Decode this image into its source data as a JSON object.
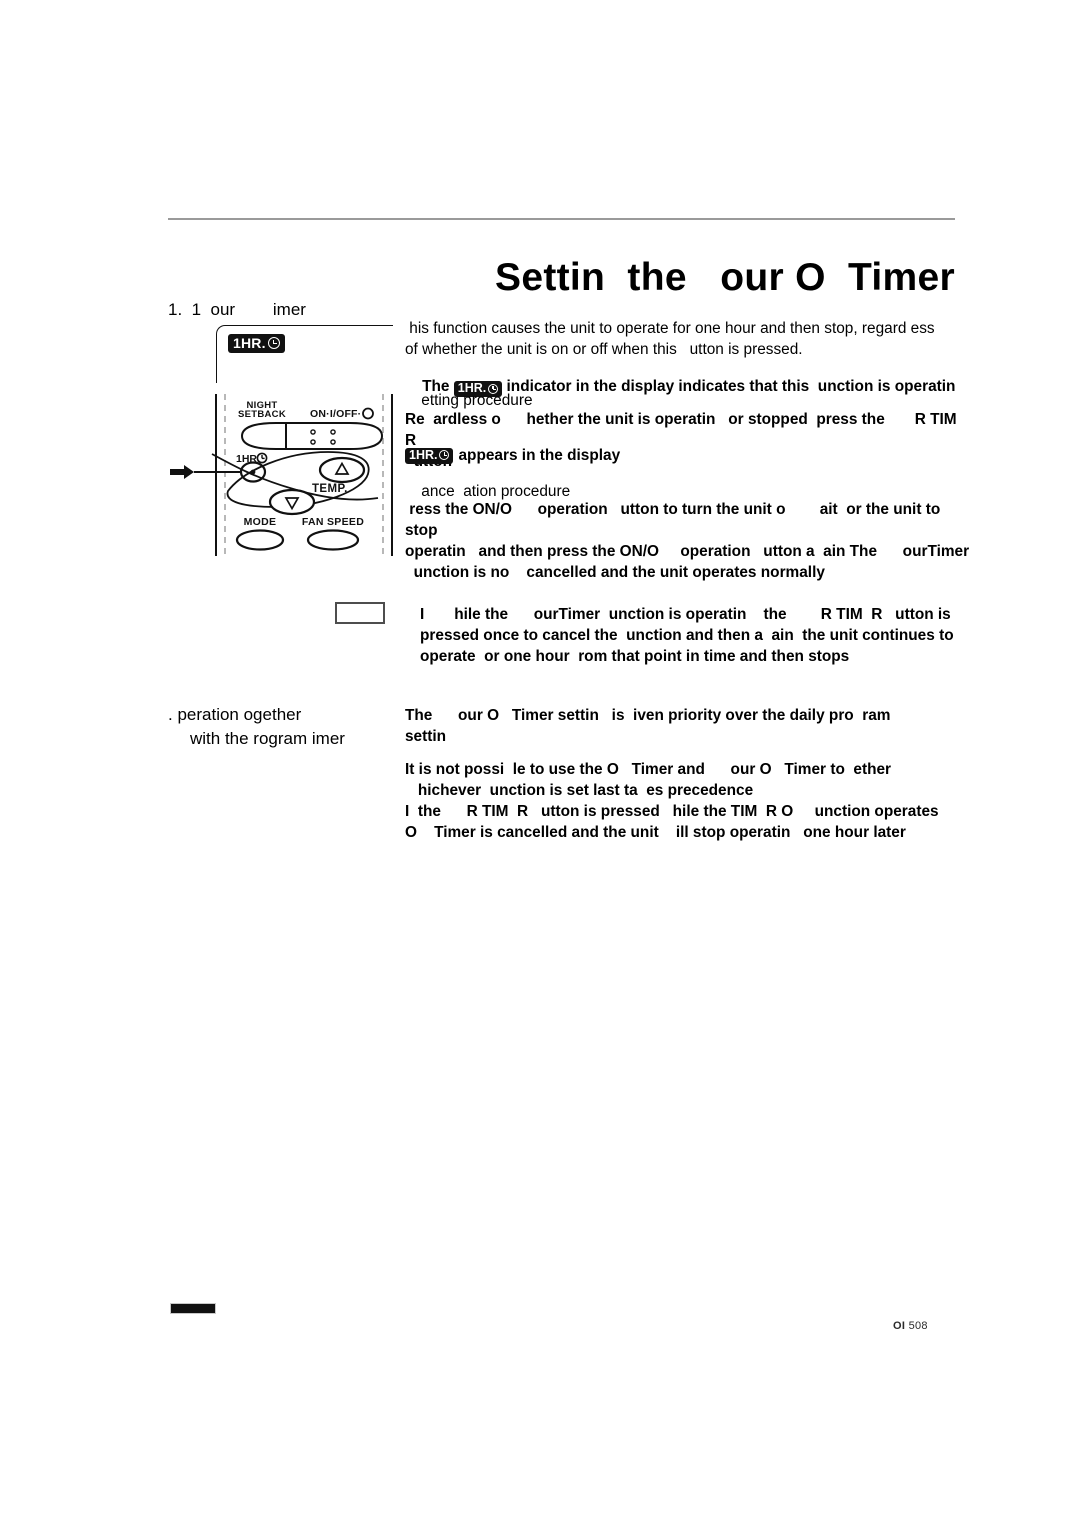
{
  "document": {
    "title": "Settin  the   our O  Timer",
    "footer_code_prefix": "OI",
    "footer_code_number": "508"
  },
  "section1": {
    "heading": "1.  1  our        imer",
    "display_badge": {
      "text": "1HR.",
      "icon": "clock-icon"
    },
    "intro_paragraph": " his function causes the unit to operate for one hour and then stop, regard ess\nof whether the unit is on or off when this   utton is pressed.",
    "intro_bold_before": "The ",
    "intro_bold_after": " indicator in the display indicates that this  unction is operatin",
    "setting_label": " etting procedure",
    "setting_body": "Re  ardless o      hether the unit is operatin   or stopped  press the       R TIM  R\n  utton",
    "setting_display_text": "appears in the display",
    "cancel_label": " ance  ation procedure",
    "cancel_body": " ress the ON/O      operation   utton to turn the unit o        ait  or the unit to stop\noperatin   and then press the ON/O     operation   utton a  ain The      ourTimer\n  unction is no    cancelled and the unit operates normally",
    "note_text": "I       hile the      ourTimer  unction is operatin    the        R TIM  R   utton is\npressed once to cancel the  unction and then a  ain  the unit continues to\noperate  or one hour  rom that point in time and then stops"
  },
  "section2": {
    "heading_line1": ".   peration  ogether",
    "heading_line2": "with the   rogram  imer",
    "body1": "The      our O   Timer settin   is  iven priority over the daily pro  ram\nsettin",
    "body2": "It is not possi  le to use the O   Timer and      our O   Timer to  ether\n   hichever  unction is set last ta  es precedence\nI  the      R TIM  R   utton is pressed   hile the TIM  R O     unction operates\nO    Timer is cancelled and the unit    ill stop operatin   one hour later"
  },
  "remote": {
    "alt": "air-conditioner remote control illustration",
    "buttons": [
      {
        "name": "night-setback",
        "label": "NIGHT\nSETBACK"
      },
      {
        "name": "on-off",
        "label": "ON·I/OFF·"
      },
      {
        "name": "one-hour-off-timer",
        "label": "1HR."
      },
      {
        "name": "temp",
        "label": "TEMP."
      },
      {
        "name": "mode",
        "label": "MODE"
      },
      {
        "name": "fan-speed",
        "label": "FAN SPEED"
      }
    ],
    "label_night_line1": "NIGHT",
    "label_night_line2": "SETBACK",
    "label_onoff": "ON·I/OFF·",
    "label_1hr": "1HR.",
    "label_temp": "TEMP.",
    "label_mode": "MODE",
    "label_fan": "FAN SPEED"
  }
}
